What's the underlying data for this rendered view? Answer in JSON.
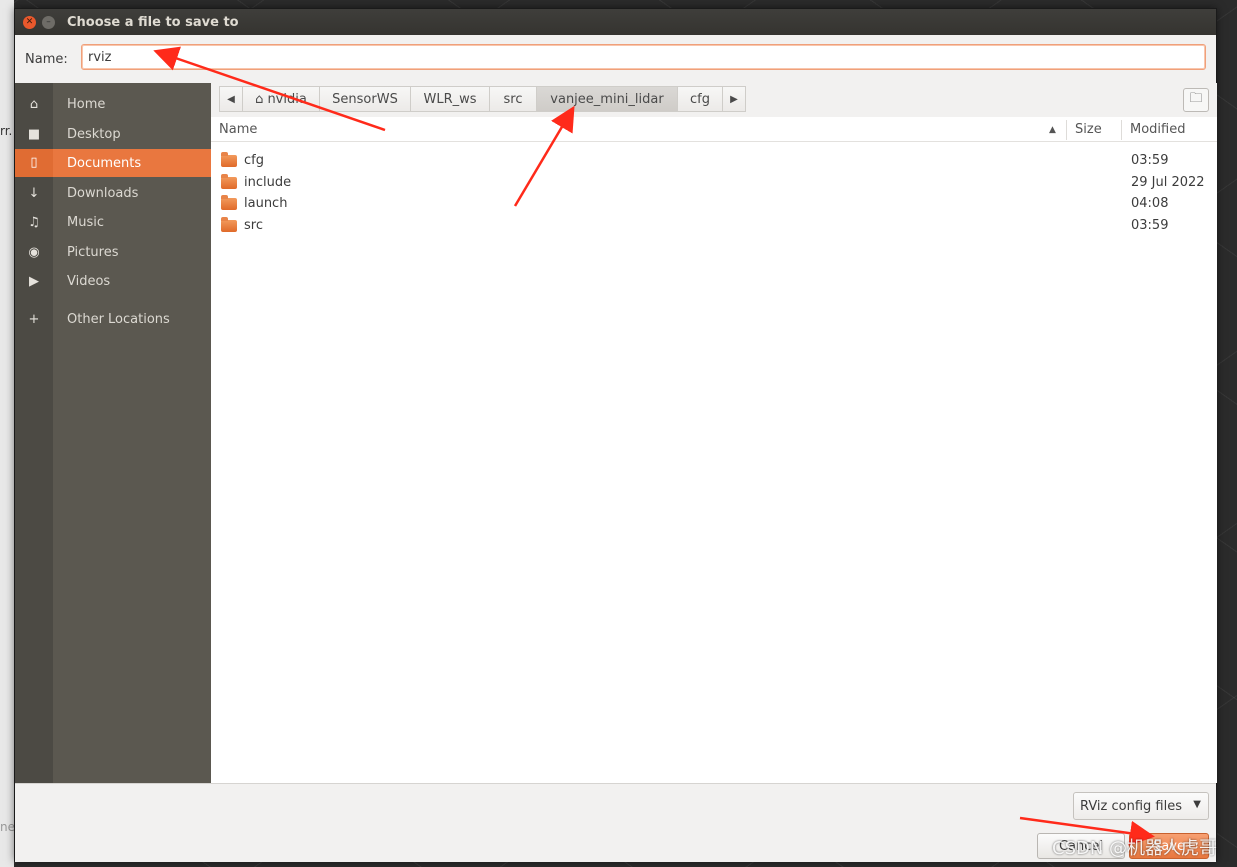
{
  "dialog": {
    "title": "Choose a file to save to",
    "name_label": "Name:",
    "name_value": "rviz"
  },
  "sidebar": {
    "items": [
      {
        "label": "Home",
        "icon": "home-icon"
      },
      {
        "label": "Desktop",
        "icon": "folder-icon"
      },
      {
        "label": "Documents",
        "icon": "document-icon",
        "active": true
      },
      {
        "label": "Downloads",
        "icon": "download-icon"
      },
      {
        "label": "Music",
        "icon": "music-icon"
      },
      {
        "label": "Pictures",
        "icon": "camera-icon"
      },
      {
        "label": "Videos",
        "icon": "video-icon"
      }
    ],
    "other_locations": "Other Locations"
  },
  "pathbar": {
    "segments": [
      "nvidia",
      "SensorWS",
      "WLR_ws",
      "src",
      "vanjee_mini_lidar",
      "cfg"
    ],
    "active_segment": "vanjee_mini_lidar"
  },
  "columns": {
    "name": "Name",
    "size": "Size",
    "modified": "Modified"
  },
  "files": [
    {
      "name": "cfg",
      "modified": "03:59"
    },
    {
      "name": "include",
      "modified": "29 Jul 2022"
    },
    {
      "name": "launch",
      "modified": "04:08"
    },
    {
      "name": "src",
      "modified": "03:59"
    }
  ],
  "bottom": {
    "filter": "RViz config files",
    "cancel": "Cancel",
    "save": "Save"
  },
  "watermark": "CSDN @机器人虎哥",
  "background": {
    "left_text_1": "rr.",
    "left_text_2": "ne"
  },
  "colors": {
    "accent": "#e9773f",
    "annotation_arrow": "#ff2a1a"
  }
}
